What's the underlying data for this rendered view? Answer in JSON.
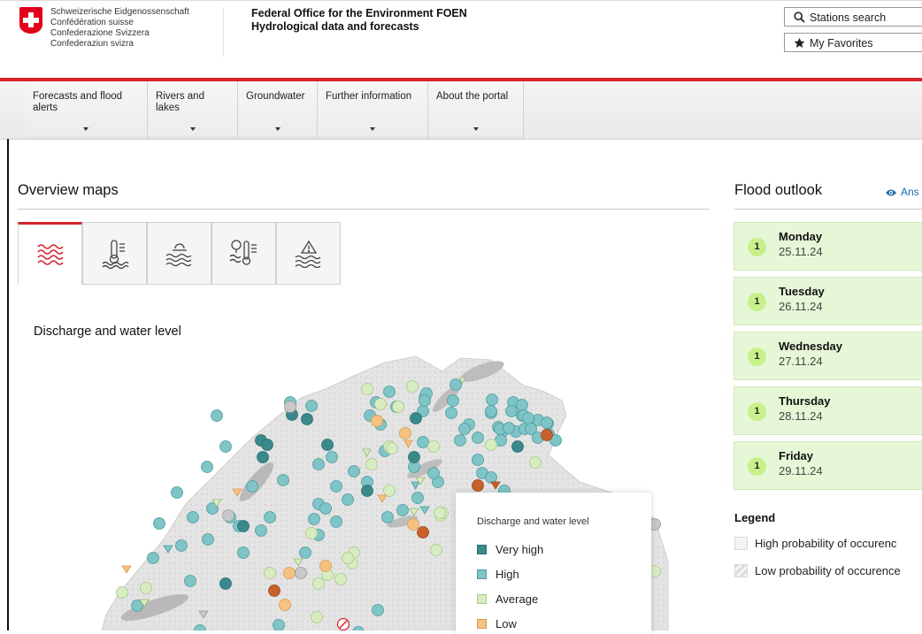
{
  "header": {
    "confederation": [
      "Schweizerische Eidgenossenschaft",
      "Confédération suisse",
      "Confederazione Svizzera",
      "Confederaziun svizra"
    ],
    "office_line1": "Federal Office for the Environment FOEN",
    "office_line2": "Hydrological data and forecasts",
    "search_label": "Stations search",
    "favorites_label": "My Favorites"
  },
  "nav": {
    "items": [
      {
        "label": "Forecasts and flood alerts"
      },
      {
        "label": "Rivers and lakes"
      },
      {
        "label": "Groundwater"
      },
      {
        "label": "Further information"
      },
      {
        "label": "About the portal"
      }
    ]
  },
  "overview": {
    "title": "Overview maps",
    "tabs": [
      {
        "icon": "waves-icon"
      },
      {
        "icon": "water-temperature-icon"
      },
      {
        "icon": "lake-level-icon"
      },
      {
        "icon": "groundwater-temperature-icon"
      },
      {
        "icon": "flood-warning-icon"
      }
    ],
    "map_title": "Discharge and water level"
  },
  "map_legend": {
    "title": "Discharge and water level",
    "items": [
      {
        "label": "Very high",
        "color": "#3a8a8c"
      },
      {
        "label": "High",
        "color": "#7fc4c6"
      },
      {
        "label": "Average",
        "color": "#d7ecc0"
      },
      {
        "label": "Low",
        "color": "#f5c282"
      }
    ]
  },
  "flood_outlook": {
    "title": "Flood outlook",
    "link_label": "Ans",
    "days": [
      {
        "level": "1",
        "day": "Monday",
        "date": "25.11.24"
      },
      {
        "level": "1",
        "day": "Tuesday",
        "date": "26.11.24"
      },
      {
        "level": "1",
        "day": "Wednesday",
        "date": "27.11.24"
      },
      {
        "level": "1",
        "day": "Thursday",
        "date": "28.11.24"
      },
      {
        "level": "1",
        "day": "Friday",
        "date": "29.11.24"
      }
    ],
    "legend_title": "Legend",
    "legend_items": [
      {
        "label": "High probability of occurenc"
      },
      {
        "label": "Low probability of occurence"
      }
    ]
  },
  "colors": {
    "accent_red": "#d8232a",
    "very_high": "#3a8a8c",
    "high": "#7fc4c6",
    "average": "#d7ecc0",
    "low": "#f5c282",
    "very_low": "#c8602a",
    "no_data": "#c8c8c8",
    "flood_level_1": "#c8f08a",
    "card_bg": "#e6f7d7"
  }
}
